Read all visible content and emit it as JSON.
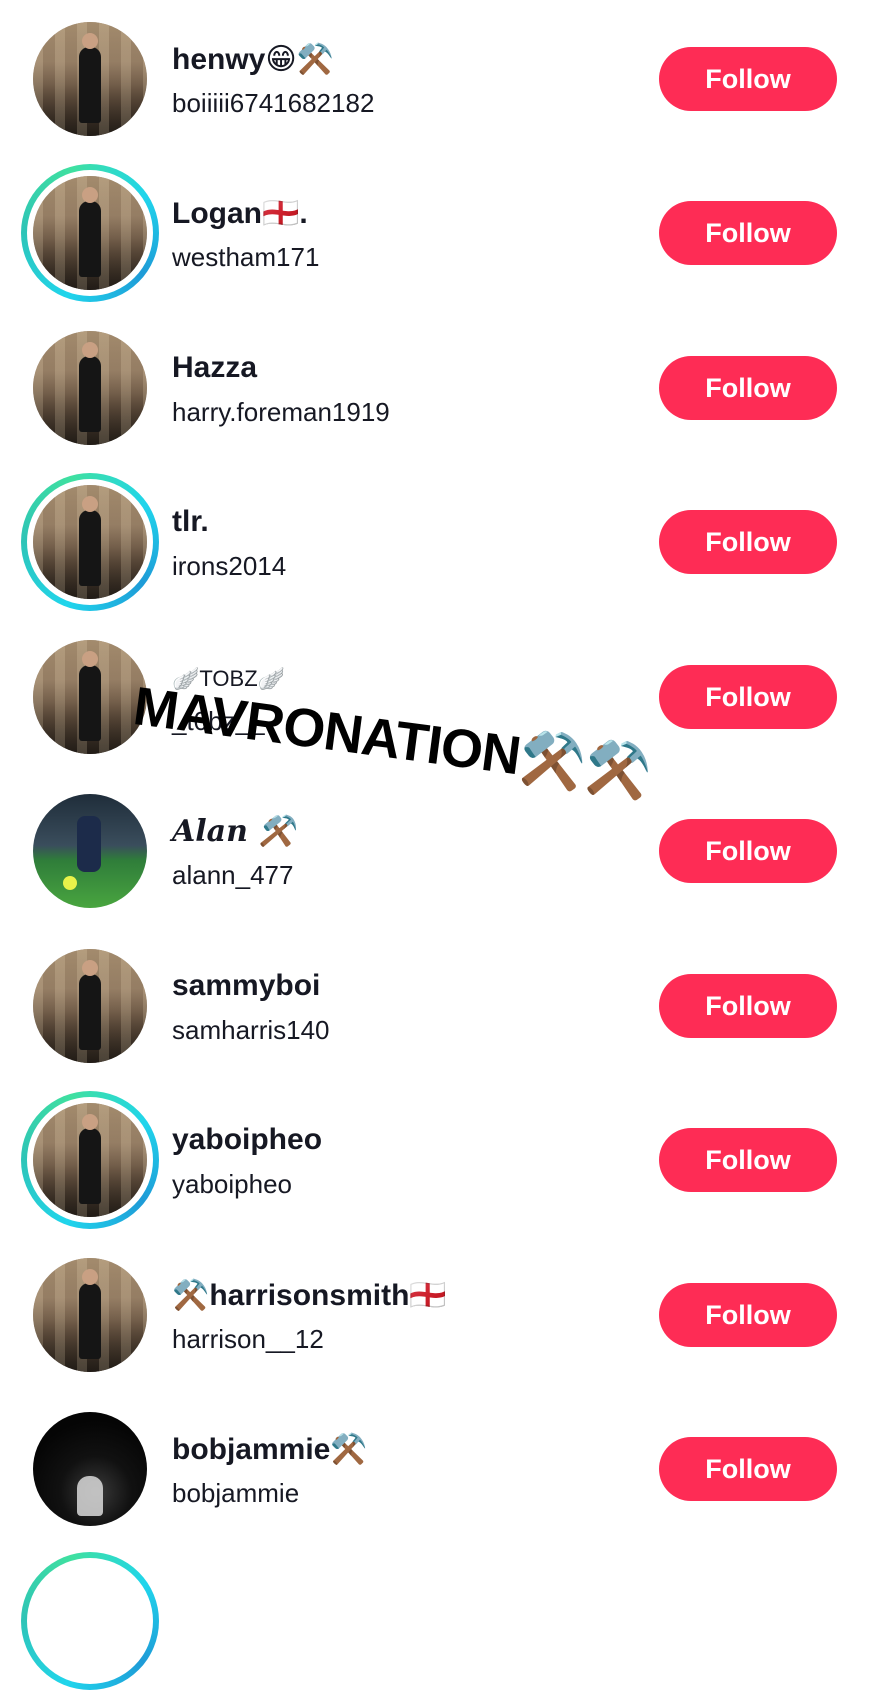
{
  "follow_list": [
    {
      "display_name": "henwy😁⚒️",
      "username": "boiiiii6741682182",
      "follow_label": "Follow",
      "story_ring": false,
      "avatar": "man-in-suit-photo"
    },
    {
      "display_name": "Logan🏴󠁧󠁢󠁥󠁮󠁧󠁿.",
      "username": "westham171",
      "follow_label": "Follow",
      "story_ring": true,
      "avatar": "man-in-suit-photo"
    },
    {
      "display_name": "Hazza",
      "username": "harry.foreman1919",
      "follow_label": "Follow",
      "story_ring": false,
      "avatar": "man-in-suit-photo"
    },
    {
      "display_name": "tlr.",
      "username": "irons2014",
      "follow_label": "Follow",
      "story_ring": true,
      "avatar": "man-in-suit-photo"
    },
    {
      "display_name": "🪽TOBZ🪽",
      "username": "_t0bz__",
      "follow_label": "Follow",
      "story_ring": false,
      "avatar": "man-in-suit-photo"
    },
    {
      "display_name": "Alan ⚒️",
      "username": "alann_477",
      "follow_label": "Follow",
      "story_ring": false,
      "avatar": "football-player-photo"
    },
    {
      "display_name": "sammyboi",
      "username": "samharris140",
      "follow_label": "Follow",
      "story_ring": false,
      "avatar": "man-in-suit-photo"
    },
    {
      "display_name": "yaboipheo",
      "username": "yaboipheo",
      "follow_label": "Follow",
      "story_ring": true,
      "avatar": "man-in-suit-photo"
    },
    {
      "display_name": "⚒️harrisonsmith🏴󠁧󠁢󠁥󠁮󠁧󠁿",
      "username": "harrison__12",
      "follow_label": "Follow",
      "story_ring": false,
      "avatar": "man-in-suit-photo"
    },
    {
      "display_name": "bobjammie⚒️",
      "username": "bobjammie",
      "follow_label": "Follow",
      "story_ring": false,
      "avatar": "dark-photo"
    }
  ],
  "overlay": {
    "text": "MAVRONATION⚒️⚒️"
  },
  "colors": {
    "follow_button": "#fe2c55",
    "follow_text": "#ffffff",
    "ring_accent": "#20d5ec",
    "text_primary": "#161823"
  }
}
